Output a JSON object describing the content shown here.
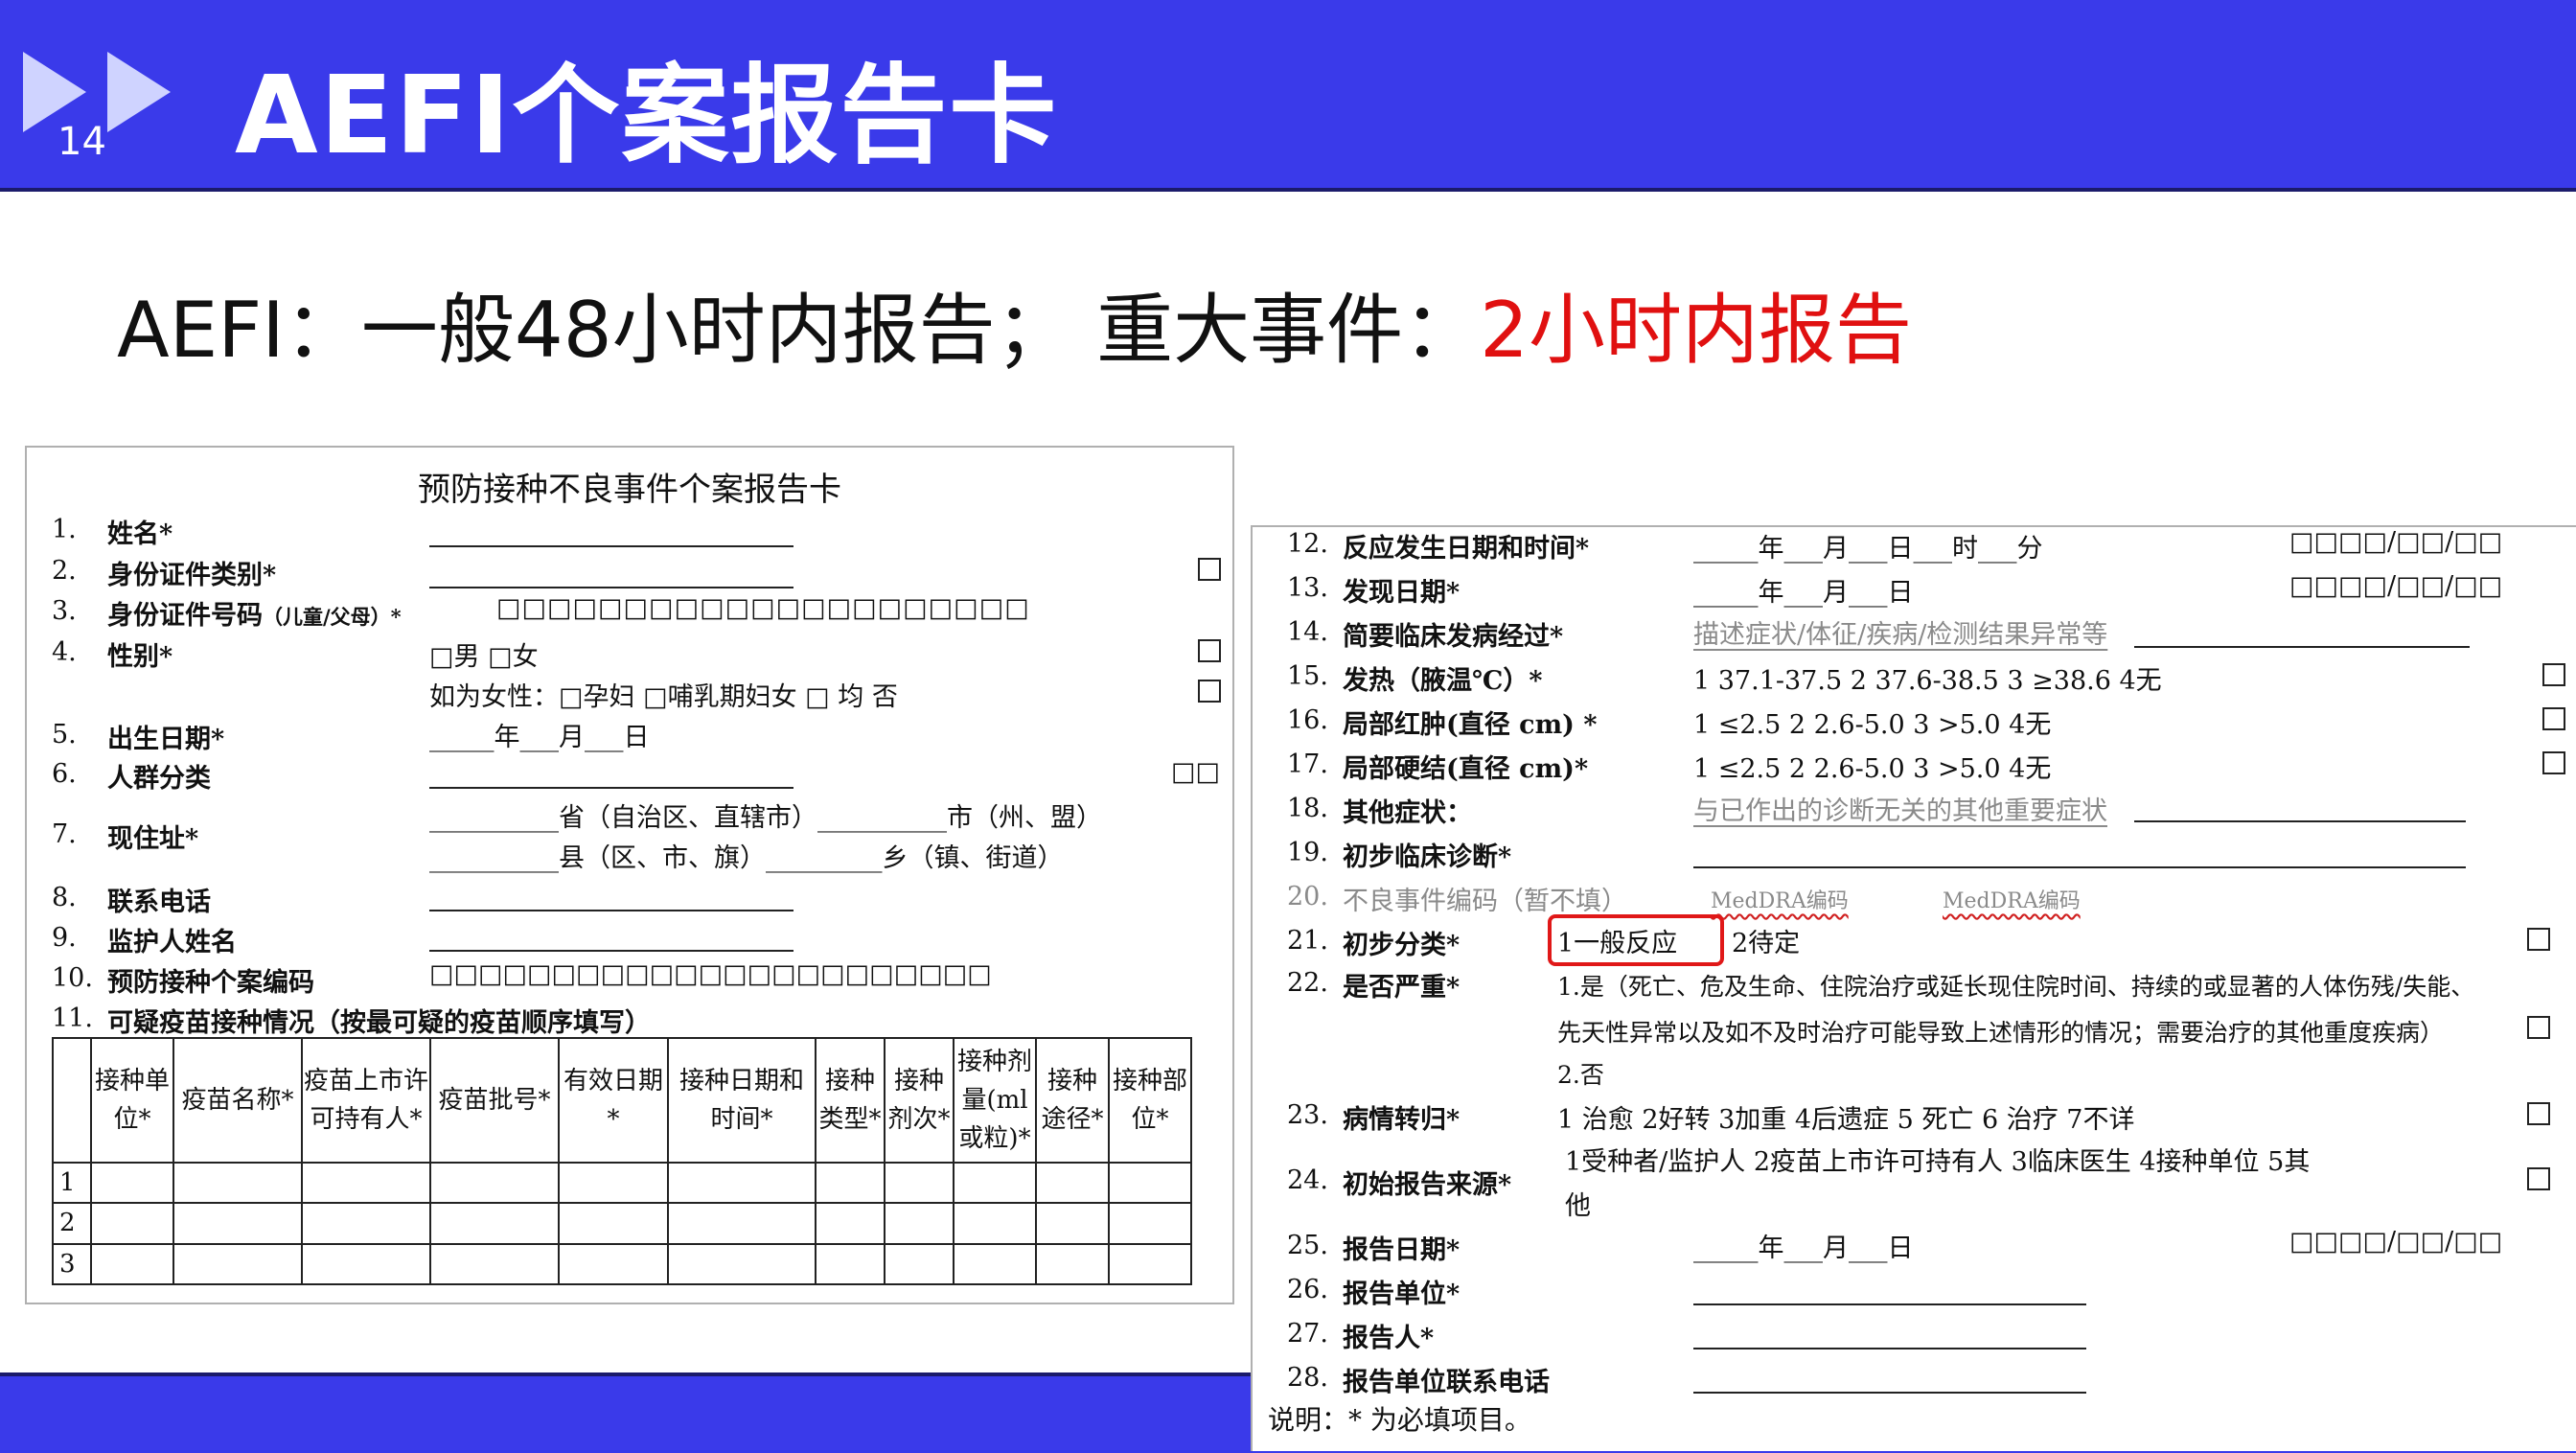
{
  "slide": {
    "number": "14",
    "title": "AEFI个案报告卡",
    "subtitle_prefix": "AEFI：一般48小时内报告； 重大事件：",
    "subtitle_highlight": "2小时内报告",
    "accent_color": "#3a3aea",
    "highlight_color": "#e01010"
  },
  "left_card": {
    "title": "预防接种不良事件个案报告卡",
    "rows": [
      {
        "num": "1.",
        "label": "姓名*"
      },
      {
        "num": "2.",
        "label": "身份证件类别*"
      },
      {
        "num": "3.",
        "label": "身份证件号码",
        "label_small": "（儿童/父母）*"
      },
      {
        "num": "4.",
        "label": "性别*"
      },
      {
        "num": "5.",
        "label": "出生日期*"
      },
      {
        "num": "6.",
        "label": "人群分类"
      },
      {
        "num": "7.",
        "label": "现住址*"
      },
      {
        "num": "8.",
        "label": "联系电话"
      },
      {
        "num": "9.",
        "label": "监护人姓名"
      },
      {
        "num": "10.",
        "label": "预防接种个案编码"
      },
      {
        "num": "11.",
        "label": "可疑疫苗接种情况（按最可疑的疫苗顺序填写）"
      }
    ],
    "id_boxes": "□□□□□□□□□□□□□□□□□□□□□",
    "case_code_boxes": "□□□□□□□□□□□□□□□□□□□□□□□",
    "gender_options": "□男  □女",
    "female_line": "如为女性：□孕妇 □哺乳期妇女 □ 均 否",
    "birth_date": "_____年___月___日",
    "address_line1": "__________省（自治区、直辖市）__________市（州、盟）",
    "address_line2": "__________县（区、市、旗）_________乡（镇、街道）",
    "group_boxes": "□□",
    "table_headers": [
      "接种单位*",
      "疫苗名称*",
      "疫苗上市许可持有人*",
      "疫苗批号*",
      "有效日期*",
      "接种日期和时间*",
      "接种类型*",
      "接种剂次*",
      "接种剂量(ml或粒)*",
      "接种途径*",
      "接种部位*"
    ],
    "table_row_numbers": [
      "1",
      "2",
      "3"
    ]
  },
  "right_card": {
    "rows": [
      {
        "num": "12.",
        "label": "反应发生日期和时间*",
        "value": "_____年___月___日___时___分",
        "boxes": "□□□□/□□/□□"
      },
      {
        "num": "13.",
        "label": "发现日期*",
        "value": "_____年___月___日",
        "boxes": "□□□□/□□/□□"
      },
      {
        "num": "14.",
        "label": "简要临床发病经过*",
        "value": "描述症状/体征/疾病/检测结果异常等"
      },
      {
        "num": "15.",
        "label": "发热（腋温℃）*",
        "value": "1  37.1-37.5   2  37.6-38.5   3  ≥38.6   4无"
      },
      {
        "num": "16.",
        "label": "局部红肿(直径 cm) *",
        "value": "1  ≤2.5      2  2.6-5.0     3  >5.0        4无"
      },
      {
        "num": "17.",
        "label": "局部硬结(直径 cm)*",
        "value": "1  ≤2.5      2  2.6-5.0     3  >5.0        4无"
      },
      {
        "num": "18.",
        "label": "其他症状：",
        "value": "与已作出的诊断无关的其他重要症状"
      },
      {
        "num": "19.",
        "label": "初步临床诊断*",
        "value": ""
      },
      {
        "num": "20.",
        "label": "不良事件编码（暂不填）",
        "value": "MedDRA编码",
        "value2": "MedDRA编码"
      },
      {
        "num": "21.",
        "label": "初步分类*",
        "value": "1一般反应",
        "value2": "2待定"
      },
      {
        "num": "22.",
        "label": "是否严重*",
        "value": "1.是（死亡、危及生命、住院治疗或延长现住院时间、持续的或显著的人体伤残/失能、",
        "value2": "先天性异常以及如不及时治疗可能导致上述情形的情况；需要治疗的其他重度疾病）",
        "value3": "2.否"
      },
      {
        "num": "23.",
        "label": "病情转归*",
        "value": "1 治愈  2好转  3加重  4后遗症  5 死亡  6 治疗  7不详"
      },
      {
        "num": "24.",
        "label": "初始报告来源*",
        "value": "1受种者/监护人  2疫苗上市许可持有人  3临床医生  4接种单位  5其",
        "value2": "他"
      },
      {
        "num": "25.",
        "label": "报告日期*",
        "value": "_____年___月___日",
        "boxes": "□□□□/□□/□□"
      },
      {
        "num": "26.",
        "label": "报告单位*",
        "value": ""
      },
      {
        "num": "27.",
        "label": "报告人*",
        "value": ""
      },
      {
        "num": "28.",
        "label": "报告单位联系电话",
        "value": ""
      }
    ],
    "note": "说明：* 为必填项目。"
  }
}
